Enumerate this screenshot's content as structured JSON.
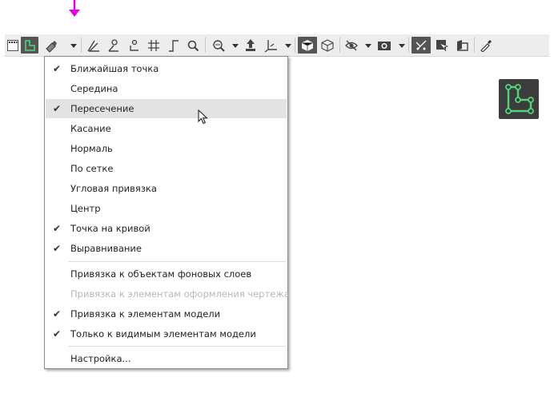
{
  "colors": {
    "accent_arrow": "#e600e6",
    "toolbar_bg": "#ededed",
    "icon_green": "#4fd67a",
    "dark_button": "#555555",
    "menu_highlight": "#e3e3e3"
  },
  "toolbar": {
    "icons": [
      "grip-icon",
      "sketch-mode-icon",
      "snap-icon",
      "angle-icon",
      "dimension-icon",
      "point-icon",
      "grid-icon",
      "ortho-icon",
      "zoom-icon",
      "zoom-window-icon",
      "move-icon",
      "axes-icon",
      "view-cube-icon",
      "wireframe-icon",
      "visibility-icon",
      "render-icon",
      "section-icon",
      "display-icon",
      "layers-icon",
      "color-picker-icon"
    ]
  },
  "menu": {
    "items": [
      {
        "label": "Ближайшая точка",
        "checked": "✔"
      },
      {
        "label": "Середина",
        "checked": ""
      },
      {
        "label": "Пересечение",
        "checked": "✔"
      },
      {
        "label": "Касание",
        "checked": ""
      },
      {
        "label": "Нормаль",
        "checked": ""
      },
      {
        "label": "По сетке",
        "checked": ""
      },
      {
        "label": "Угловая привязка",
        "checked": ""
      },
      {
        "label": "Центр",
        "checked": ""
      },
      {
        "label": "Точка на кривой",
        "checked": "✔"
      },
      {
        "label": "Выравнивание",
        "checked": "✔"
      }
    ],
    "items2": [
      {
        "label": "Привязка к объектам фоновых слоев",
        "checked": ""
      },
      {
        "label": "Привязка к элементам оформления чертежа",
        "checked": ""
      },
      {
        "label": "Привязка к элементам модели",
        "checked": "✔"
      },
      {
        "label": "Только к видимым элементам модели",
        "checked": "✔"
      }
    ],
    "settings_label": "Настройка..."
  }
}
